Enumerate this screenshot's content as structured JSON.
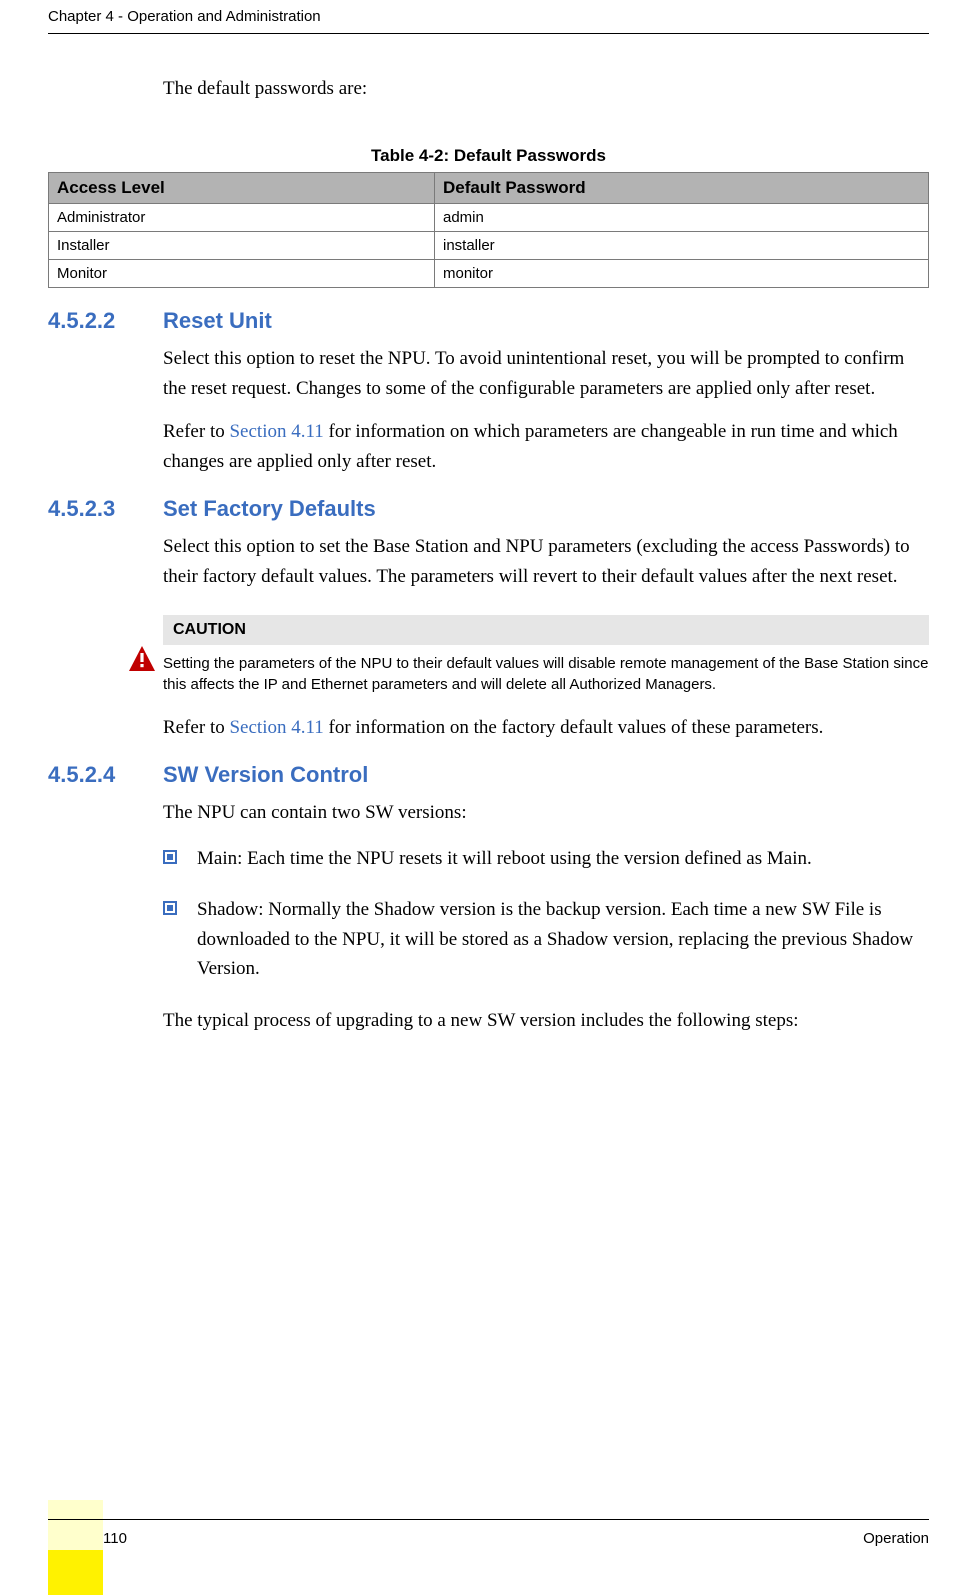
{
  "header": "Chapter 4 - Operation and Administration",
  "intro": "The default passwords are:",
  "table": {
    "caption": "Table 4-2: Default Passwords",
    "col1": "Access Level",
    "col2": "Default Password",
    "rows": [
      {
        "level": "Administrator",
        "pw": "admin"
      },
      {
        "level": "Installer",
        "pw": "installer"
      },
      {
        "level": "Monitor",
        "pw": "monitor"
      }
    ]
  },
  "sections": {
    "reset": {
      "num": "4.5.2.2",
      "title": "Reset Unit",
      "p1": "Select this option to reset the NPU. To avoid unintentional reset, you will be prompted to confirm the reset request. Changes to some of the configurable parameters are applied only after reset.",
      "p2a": "Refer to ",
      "p2link": "Section 4.11",
      "p2b": " for information on which parameters are changeable in run time and which changes are applied only after reset."
    },
    "factory": {
      "num": "4.5.2.3",
      "title": "Set Factory Defaults",
      "p1": "Select this option to set the Base Station and NPU parameters (excluding the access Passwords) to their factory default values. The parameters will revert to their default values after the next reset.",
      "caution_title": "CAUTION",
      "caution_text": "Setting the parameters of the NPU to their default values will disable remote management of the Base Station since this affects the IP and Ethernet parameters and will delete all Authorized Managers.",
      "p2a": "Refer to ",
      "p2link": "Section 4.11",
      "p2b": " for information on the factory default values of these parameters."
    },
    "sw": {
      "num": "4.5.2.4",
      "title": "SW Version Control",
      "p1": "The NPU can contain two SW versions:",
      "b1": "Main: Each time the NPU resets it will reboot using the version defined as Main.",
      "b2": "Shadow: Normally the Shadow version is the backup version. Each time a new SW File is downloaded to the NPU, it will be stored as a Shadow version, replacing the previous Shadow Version.",
      "p2": "The typical process of upgrading to a new SW version includes the following steps:"
    }
  },
  "footer": {
    "page": "110",
    "label": "Operation"
  }
}
